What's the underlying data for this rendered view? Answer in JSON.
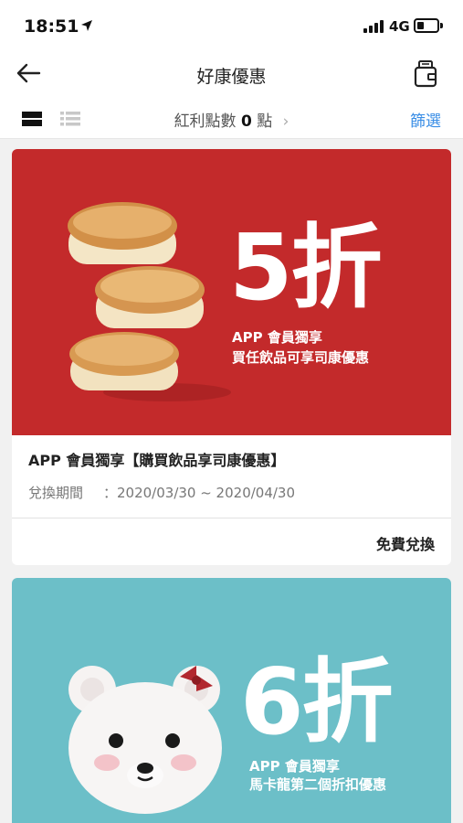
{
  "status": {
    "time": "18:51",
    "network": "4G",
    "battery_level": 0.3
  },
  "nav": {
    "title": "好康優惠"
  },
  "toolbar": {
    "points_label": "紅利點數",
    "points_value": "0",
    "points_unit": "點",
    "filter_label": "篩選"
  },
  "offers": [
    {
      "banner_big": "5折",
      "banner_line1": "APP 會員獨享",
      "banner_line2": "買任飲品可享司康優惠",
      "title": "APP 會員獨享【購買飲品享司康優惠】",
      "period_label": "兌換期間",
      "period_value": "：2020/03/30 ~ 2020/04/30",
      "action_label": "免費兌換",
      "banner_color": "#c32a2b"
    },
    {
      "banner_big": "6折",
      "banner_line1": "APP 會員獨享",
      "banner_line2": "馬卡龍第二個折扣優惠",
      "banner_color": "#6cbfc8"
    }
  ]
}
